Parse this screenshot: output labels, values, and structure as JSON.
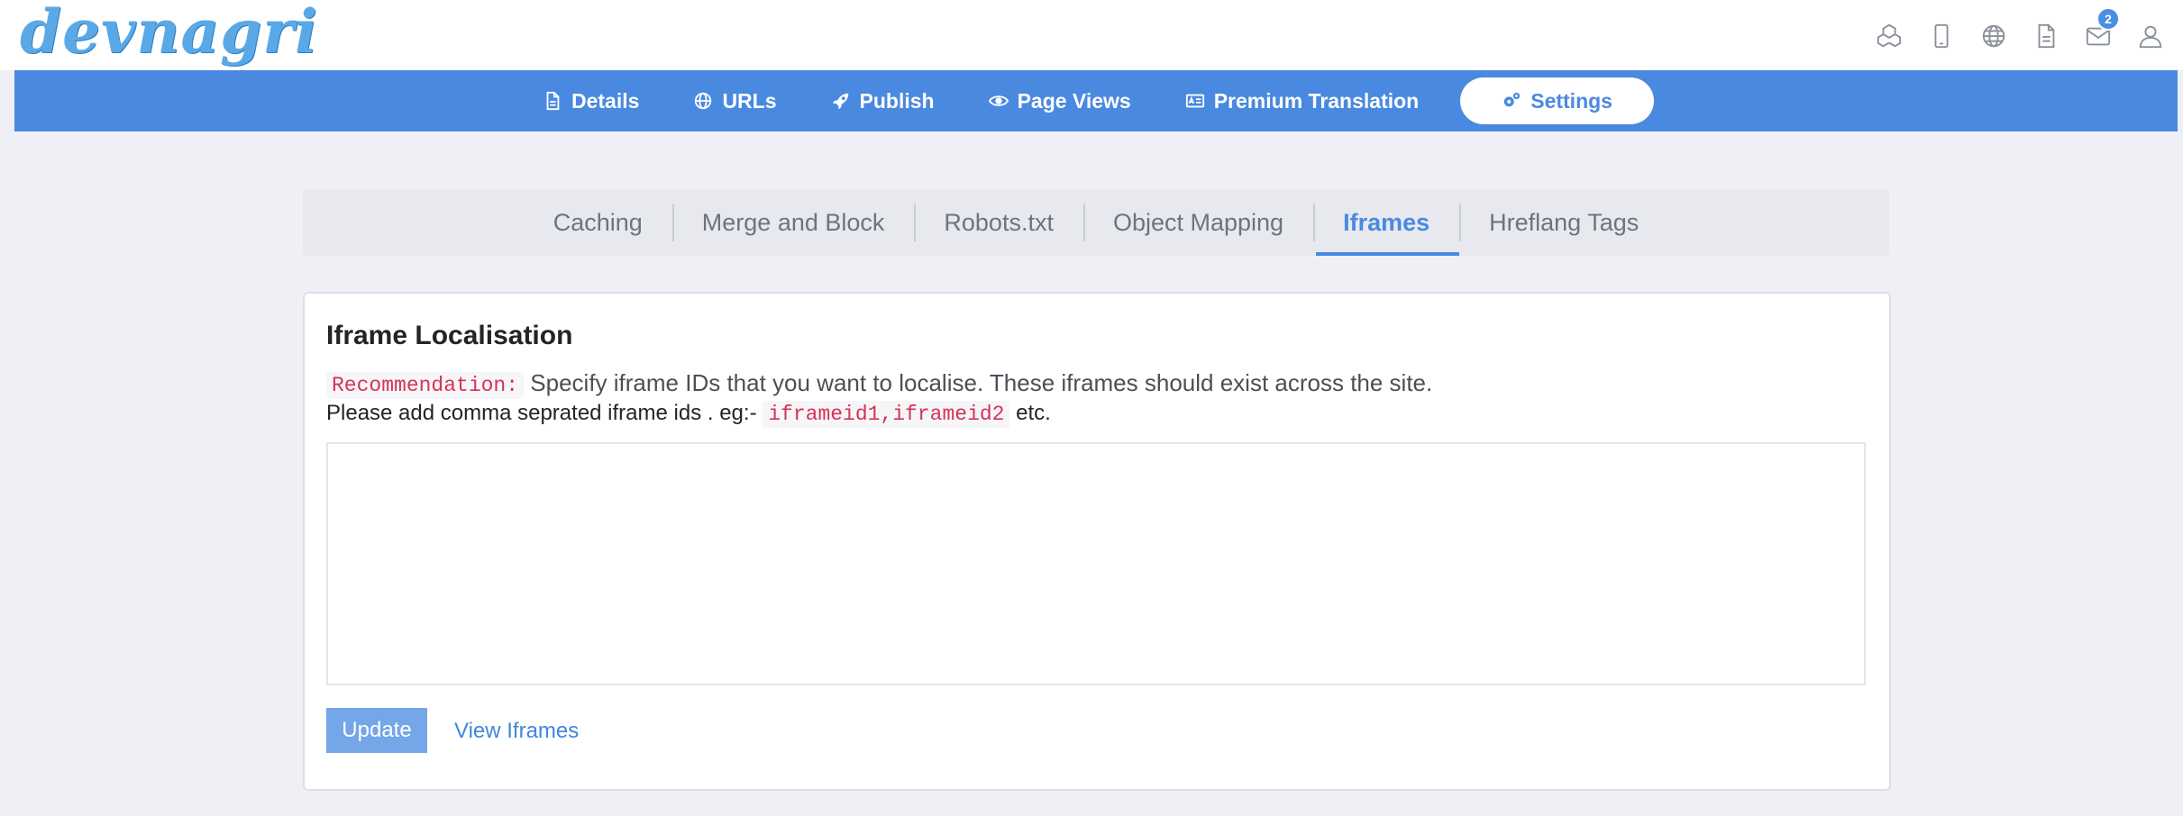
{
  "brand": {
    "logo_text": "devnagri"
  },
  "header_icons": [
    {
      "name": "cubes-icon"
    },
    {
      "name": "mobile-icon"
    },
    {
      "name": "globe-icon"
    },
    {
      "name": "document-icon"
    },
    {
      "name": "mail-icon",
      "badge": "2"
    },
    {
      "name": "user-icon"
    }
  ],
  "nav": {
    "items": [
      {
        "label": "Details",
        "icon": "file-icon"
      },
      {
        "label": "URLs",
        "icon": "globe-icon"
      },
      {
        "label": "Publish",
        "icon": "rocket-icon"
      },
      {
        "label": "Page Views",
        "icon": "eye-icon"
      },
      {
        "label": "Premium Translation",
        "icon": "id-card-icon"
      },
      {
        "label": "Settings",
        "icon": "cogs-icon",
        "active": true
      }
    ]
  },
  "subtabs": [
    {
      "label": "Caching"
    },
    {
      "label": "Merge and Block"
    },
    {
      "label": "Robots.txt"
    },
    {
      "label": "Object Mapping"
    },
    {
      "label": "Iframes",
      "active": true
    },
    {
      "label": "Hreflang Tags"
    }
  ],
  "card": {
    "title": "Iframe Localisation",
    "recommendation_label": "Recommendation:",
    "recommendation_text": "Specify iframe IDs that you want to localise. These iframes should exist across the site.",
    "hint_prefix": "Please add comma seprated iframe ids . eg:-",
    "hint_code": "iframeid1,iframeid2",
    "hint_suffix": "etc.",
    "textarea_value": "",
    "update_label": "Update",
    "view_label": "View Iframes"
  },
  "colors": {
    "accent": "#4a89e0",
    "navbar": "#4a89e0",
    "page_bg": "#eef0f5",
    "code_text": "#d63355"
  }
}
